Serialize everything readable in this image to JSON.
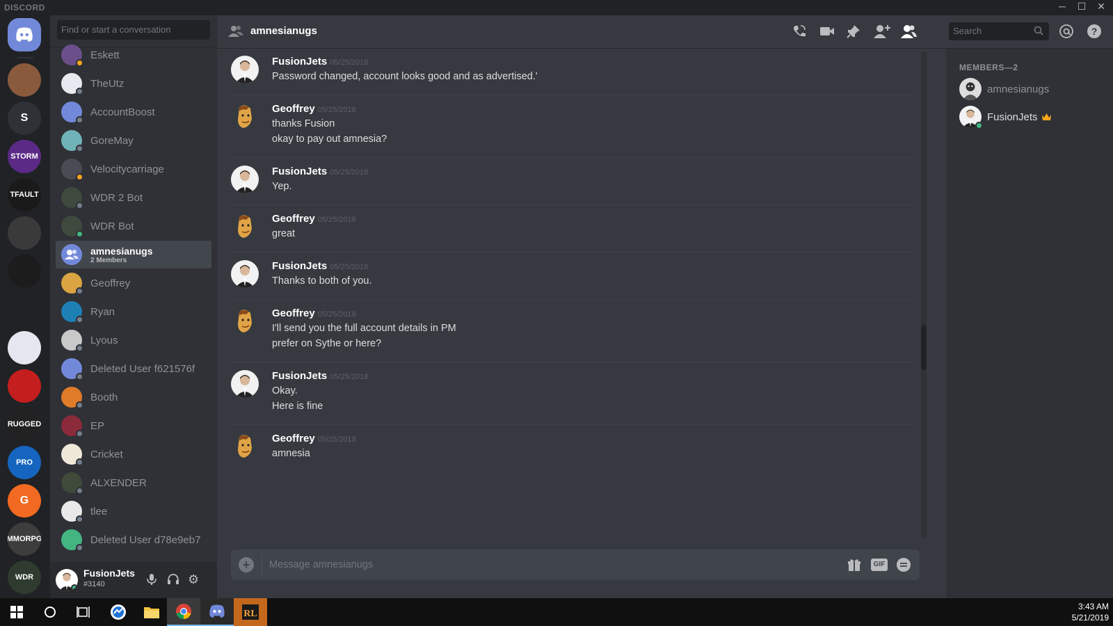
{
  "app": {
    "brand": "DISCORD"
  },
  "window_controls": {
    "minimize": "─",
    "maximize": "☐",
    "close": "✕"
  },
  "guilds": [
    {
      "name": "discord-home",
      "color": "#7289da",
      "label": ""
    },
    {
      "name": "user-avatar-guild",
      "color": "#8a5a3c",
      "label": ""
    },
    {
      "name": "s-server",
      "color": "#2f3136",
      "label": "S"
    },
    {
      "name": "storm-server",
      "color": "#5b2a86",
      "label": "STORM"
    },
    {
      "name": "tfault-scrims-server",
      "color": "#1a1a1a",
      "label": "TFAULT"
    },
    {
      "name": "smiley-server",
      "color": "#3a3a3a",
      "label": ""
    },
    {
      "name": "dark-server",
      "color": "#1c1c1c",
      "label": ""
    },
    {
      "name": "chart-server",
      "color": "#202225",
      "label": ""
    },
    {
      "name": "pink-server",
      "color": "#e6e6f0",
      "label": ""
    },
    {
      "name": "radioactive-server",
      "color": "#c41e1e",
      "label": ""
    },
    {
      "name": "rugged-server",
      "color": "#222",
      "label": "RUGGED"
    },
    {
      "name": "pro-scrims-server",
      "color": "#1565c0",
      "label": "PRO"
    },
    {
      "name": "g-server",
      "color": "#f26a21",
      "label": "G"
    },
    {
      "name": "mmorpg-server",
      "color": "#3d3d3d",
      "label": "MMORPG"
    },
    {
      "name": "wdr-server",
      "color": "#2e3b2e",
      "label": "WDR"
    }
  ],
  "sidebar": {
    "search_placeholder": "Find or start a conversation",
    "dms": [
      {
        "name": "Eskett",
        "color": "#6b4f8a",
        "status": "#faa61a"
      },
      {
        "name": "TheUtz",
        "color": "#e8e8f0",
        "status": "#747f8d"
      },
      {
        "name": "AccountBoost",
        "color": "#7289da",
        "status": "#747f8d"
      },
      {
        "name": "GoreMay",
        "color": "#6fb3b8",
        "status": "#747f8d"
      },
      {
        "name": "Velocitycarriage",
        "color": "#4b4b55",
        "status": "#faa61a"
      },
      {
        "name": "WDR 2 Bot",
        "color": "#3e4a3e",
        "status": "#747f8d"
      },
      {
        "name": "WDR Bot",
        "color": "#3e4a3e",
        "status": "#43b581"
      },
      {
        "name": "amnesianugs",
        "sub": "2 Members",
        "color": "#7289da",
        "status": "",
        "active": true
      },
      {
        "name": "Geoffrey",
        "color": "#d9a441",
        "status": "#747f8d"
      },
      {
        "name": "Ryan",
        "color": "#1e7fb5",
        "status": "#747f8d"
      },
      {
        "name": "Lyous",
        "color": "#c9c9c9",
        "status": "#747f8d"
      },
      {
        "name": "Deleted User f621576f",
        "color": "#7289da",
        "status": "#747f8d"
      },
      {
        "name": "Booth",
        "color": "#e07b2a",
        "status": "#747f8d"
      },
      {
        "name": "EP",
        "color": "#8a2a3a",
        "status": "#747f8d"
      },
      {
        "name": "Cricket",
        "color": "#efe7d8",
        "status": "#747f8d"
      },
      {
        "name": "ALXENDER",
        "color": "#3f4a3a",
        "status": "#747f8d"
      },
      {
        "name": "tlee",
        "color": "#e9e9e9",
        "status": "#747f8d"
      },
      {
        "name": "Deleted User d78e9eb7",
        "color": "#43b581",
        "status": "#747f8d"
      }
    ]
  },
  "user": {
    "name": "FusionJets",
    "tag": "#3140"
  },
  "channel": {
    "name": "amnesianugs",
    "search_placeholder": "Search",
    "composer_placeholder": "Message amnesianugs"
  },
  "messages": [
    {
      "author": "FusionJets",
      "avatar": "fusion",
      "ts": "05/25/2018",
      "lines": [
        "Password changed, account looks good and as advertised.'"
      ]
    },
    {
      "author": "Geoffrey",
      "avatar": "geoffrey",
      "ts": "05/25/2018",
      "lines": [
        "thanks Fusion",
        "okay to pay out amnesia?"
      ]
    },
    {
      "author": "FusionJets",
      "avatar": "fusion",
      "ts": "05/25/2018",
      "lines": [
        "Yep."
      ]
    },
    {
      "author": "Geoffrey",
      "avatar": "geoffrey",
      "ts": "05/25/2018",
      "lines": [
        "great"
      ]
    },
    {
      "author": "FusionJets",
      "avatar": "fusion",
      "ts": "05/25/2018",
      "lines": [
        "Thanks to both of you."
      ]
    },
    {
      "author": "Geoffrey",
      "avatar": "geoffrey",
      "ts": "05/25/2018",
      "lines": [
        "I'll send you the full account details in PM",
        "prefer on Sythe or here?"
      ]
    },
    {
      "author": "FusionJets",
      "avatar": "fusion",
      "ts": "05/25/2018",
      "lines": [
        "Okay.",
        "Here is fine"
      ]
    },
    {
      "author": "Geoffrey",
      "avatar": "geoffrey",
      "ts": "05/25/2018",
      "lines": [
        "amnesia"
      ]
    }
  ],
  "members": {
    "header": "MEMBERS—2",
    "list": [
      {
        "name": "amnesianugs",
        "avatar": "amnesia",
        "status": "",
        "owner": false
      },
      {
        "name": "FusionJets",
        "avatar": "fusion",
        "status": "#43b581",
        "owner": true
      }
    ]
  },
  "taskbar": {
    "time": "3:43 AM",
    "date": "5/21/2019"
  }
}
